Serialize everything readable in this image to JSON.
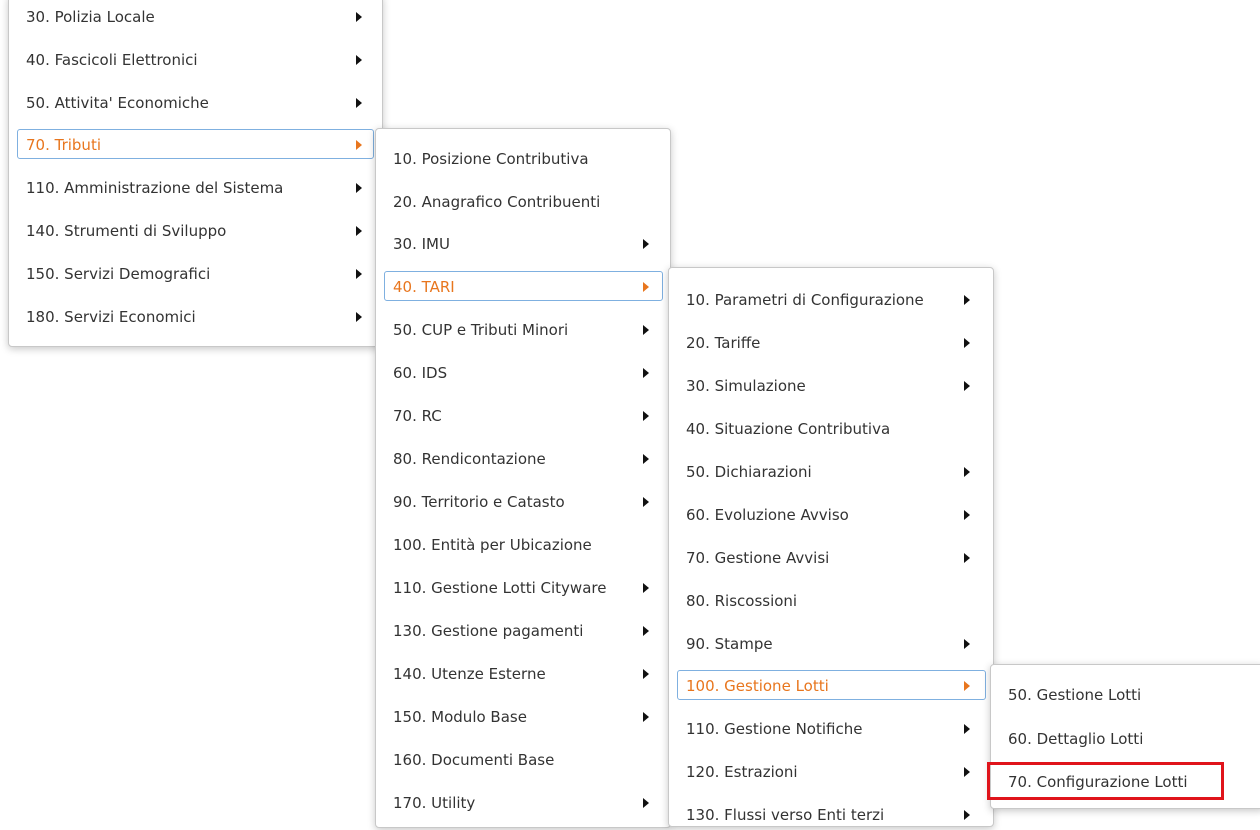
{
  "menu1": {
    "items": [
      {
        "label": "30. Polizia Locale",
        "submenu": true
      },
      {
        "label": "40. Fascicoli Elettronici",
        "submenu": true
      },
      {
        "label": "50. Attivita' Economiche",
        "submenu": true
      },
      {
        "label": "70. Tributi",
        "submenu": true,
        "active": true
      },
      {
        "label": "110. Amministrazione del Sistema",
        "submenu": true
      },
      {
        "label": "140. Strumenti di Sviluppo",
        "submenu": true
      },
      {
        "label": "150. Servizi Demografici",
        "submenu": true
      },
      {
        "label": "180. Servizi Economici",
        "submenu": true
      }
    ]
  },
  "menu2": {
    "items": [
      {
        "label": "10. Posizione Contributiva",
        "submenu": false
      },
      {
        "label": "20. Anagrafico Contribuenti",
        "submenu": false
      },
      {
        "label": "30. IMU",
        "submenu": true
      },
      {
        "label": "40. TARI",
        "submenu": true,
        "active": true
      },
      {
        "label": "50. CUP e Tributi Minori",
        "submenu": true
      },
      {
        "label": "60. IDS",
        "submenu": true
      },
      {
        "label": "70. RC",
        "submenu": true
      },
      {
        "label": "80. Rendicontazione",
        "submenu": true
      },
      {
        "label": "90. Territorio e Catasto",
        "submenu": true
      },
      {
        "label": "100. Entità per Ubicazione",
        "submenu": false
      },
      {
        "label": "110. Gestione Lotti Cityware",
        "submenu": true
      },
      {
        "label": "130. Gestione pagamenti",
        "submenu": true
      },
      {
        "label": "140. Utenze Esterne",
        "submenu": true
      },
      {
        "label": "150. Modulo Base",
        "submenu": true
      },
      {
        "label": "160. Documenti Base",
        "submenu": false
      },
      {
        "label": "170. Utility",
        "submenu": true
      }
    ]
  },
  "menu3": {
    "items": [
      {
        "label": "10. Parametri di Configurazione",
        "submenu": true
      },
      {
        "label": "20. Tariffe",
        "submenu": true
      },
      {
        "label": "30. Simulazione",
        "submenu": true
      },
      {
        "label": "40. Situazione Contributiva",
        "submenu": false
      },
      {
        "label": "50. Dichiarazioni",
        "submenu": true
      },
      {
        "label": "60. Evoluzione Avviso",
        "submenu": true
      },
      {
        "label": "70. Gestione Avvisi",
        "submenu": true
      },
      {
        "label": "80. Riscossioni",
        "submenu": false
      },
      {
        "label": "90. Stampe",
        "submenu": true
      },
      {
        "label": "100. Gestione Lotti",
        "submenu": true,
        "active": true
      },
      {
        "label": "110. Gestione Notifiche",
        "submenu": true
      },
      {
        "label": "120. Estrazioni",
        "submenu": true
      },
      {
        "label": "130. Flussi verso Enti terzi",
        "submenu": true
      }
    ]
  },
  "menu4": {
    "items": [
      {
        "label": "50. Gestione Lotti",
        "submenu": false
      },
      {
        "label": "60. Dettaglio Lotti",
        "submenu": false
      },
      {
        "label": "70. Configurazione Lotti",
        "submenu": false,
        "highlighted": true
      }
    ]
  },
  "colors": {
    "active_text": "#e8761e",
    "active_border": "#7fb0e0",
    "highlight_box": "#e0141b"
  }
}
